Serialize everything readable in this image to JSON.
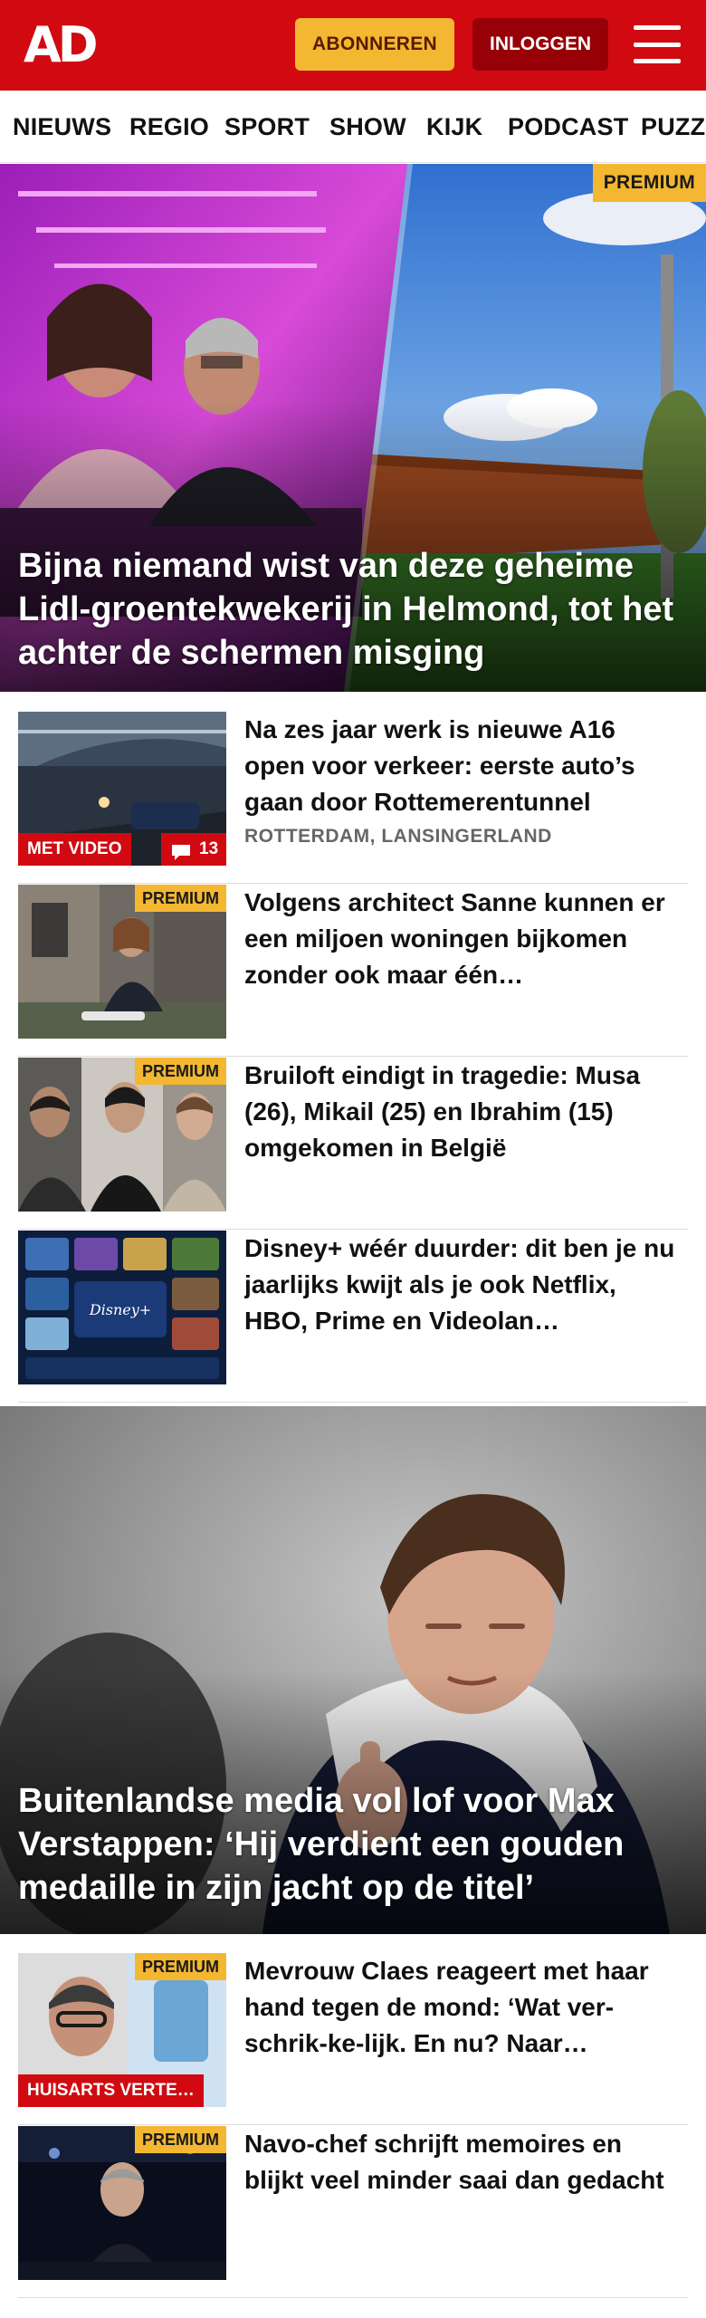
{
  "header": {
    "logo": "AD",
    "subscribe_label": "ABONNEREN",
    "login_label": "INLOGGEN",
    "brand_red": "#d10a11",
    "accent_yellow": "#f3b731"
  },
  "nav": {
    "items": [
      "NIEUWS",
      "REGIO",
      "SPORT",
      "SHOW",
      "KIJK",
      "PODCAST",
      "PUZZ"
    ]
  },
  "hero1": {
    "badge": "PREMIUM",
    "title": "Bijna niemand wist van deze geheime Lidl-groentekwekerij in Helmond, tot het achter de schermen misging"
  },
  "articles1": [
    {
      "title": "Na zes jaar werk is nieuwe A16 open voor verkeer: eerste auto’s gaan door Rottemerentunnel",
      "meta": "ROTTERDAM, LANSINGERLAND",
      "label": "MET VIDEO",
      "comments": "13"
    },
    {
      "badge": "PREMIUM",
      "title": "Volgens architect Sanne kunnen er een miljoen woningen bijkomen zonder ook maar één…"
    },
    {
      "badge": "PREMIUM",
      "title": "Bruiloft eindigt in tragedie: Musa (26), Mikail (25) en Ibrahim (15) omgekomen in België"
    },
    {
      "title": "Disney+ wéér duurder: dit ben je nu jaarlijks kwijt als je ook Netflix, HBO, Prime en Videolan…"
    }
  ],
  "hero2": {
    "title": "Buitenlandse media vol lof voor Max Verstappen: ‘Hij verdient een gouden medaille in zijn jacht op de titel’"
  },
  "articles2": [
    {
      "badge": "PREMIUM",
      "label": "HUISARTS VERTE…",
      "title": "Mevrouw Claes reageert met haar hand tegen de mond: ‘Wat ver-schrik-ke-lijk. En nu? Naar…"
    },
    {
      "badge": "PREMIUM",
      "title": "Navo-chef schrijft memoires en blijkt veel minder saai dan gedacht"
    }
  ]
}
